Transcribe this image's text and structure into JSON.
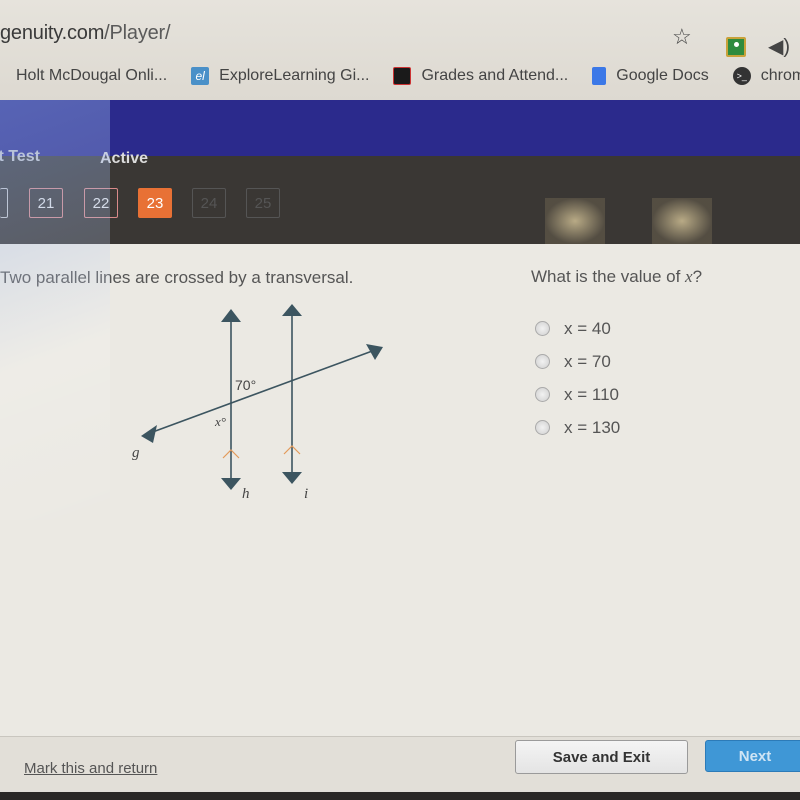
{
  "browser": {
    "url_host": "genuity.com",
    "url_path": "/Player/",
    "bookmarks": [
      {
        "label": "Holt McDougal Onli...",
        "icon": "holt-icon"
      },
      {
        "label": "ExploreLearning Gi...",
        "icon": "explorelearning-icon",
        "glyph": "el"
      },
      {
        "label": "Grades and Attend...",
        "icon": "powerschool-icon"
      },
      {
        "label": "Google Docs",
        "icon": "google-docs-icon"
      },
      {
        "label": "chrome",
        "icon": "chrome-terminal-icon",
        "glyph": ">_"
      }
    ]
  },
  "header": {
    "test_label": "it Test",
    "status": "Active",
    "questions": [
      {
        "num": "21",
        "state": "visited"
      },
      {
        "num": "22",
        "state": "visited"
      },
      {
        "num": "23",
        "state": "current"
      },
      {
        "num": "24",
        "state": "upcoming"
      },
      {
        "num": "25",
        "state": "upcoming"
      }
    ]
  },
  "problem": {
    "prompt": "Two parallel lines are crossed by a transversal.",
    "question_prefix": "What is the value of ",
    "question_var": "x",
    "question_suffix": "?",
    "diagram": {
      "angle_given": "70°",
      "angle_unknown": "x°",
      "transversal_label": "g",
      "line1_label": "h",
      "line2_label": "i"
    },
    "options": [
      "x = 40",
      "x = 70",
      "x = 110",
      "x = 130"
    ]
  },
  "footer": {
    "mark_label": "Mark this and return",
    "save_label": "Save and Exit",
    "next_label": "Next"
  },
  "colors": {
    "header_blue": "#2b2a8c",
    "current_question": "#e87135",
    "next_button": "#3f97d6",
    "diagram_line": "#3c5560",
    "parallel_mark": "#e39a5a"
  }
}
